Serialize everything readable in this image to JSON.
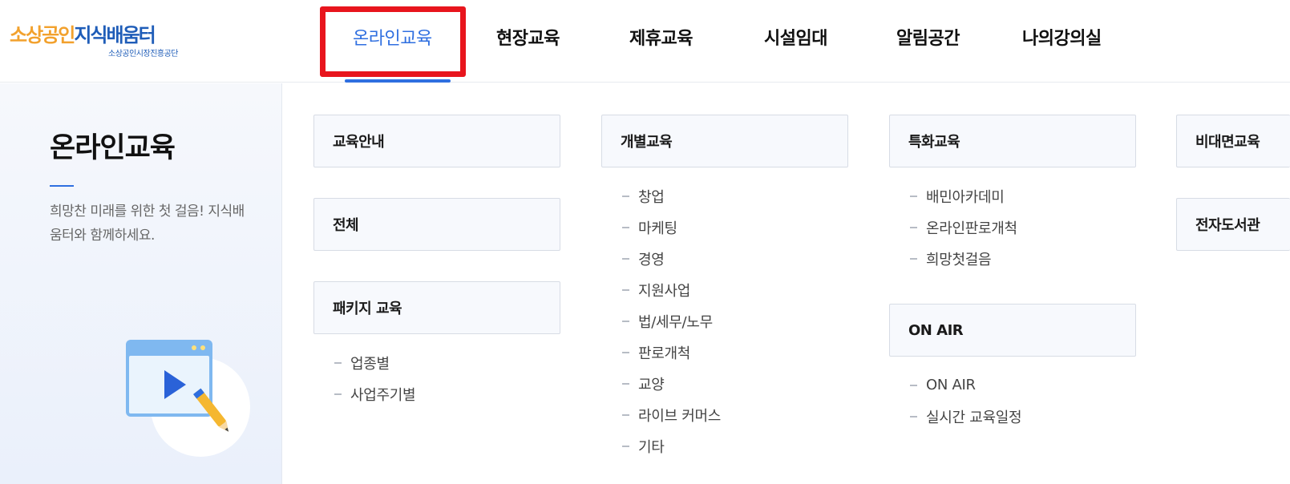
{
  "logo": {
    "main_part1": "소상공인",
    "main_part2": "지식배움터",
    "sub": "소상공인시장진흥공단"
  },
  "gnb": [
    {
      "label": "온라인교육",
      "active": true
    },
    {
      "label": "현장교육"
    },
    {
      "label": "제휴교육"
    },
    {
      "label": "시설임대"
    },
    {
      "label": "알림공간"
    },
    {
      "label": "나의강의실"
    }
  ],
  "side": {
    "title": "온라인교육",
    "description": "희망찬 미래를 위한 첫 걸음! 지식배움터와 함께하세요.",
    "illustration": "video-lesson-icon"
  },
  "columns": [
    {
      "sections": [
        {
          "title": "교육안내",
          "items": []
        },
        {
          "title": "전체",
          "items": []
        },
        {
          "title": "패키지 교육",
          "items": [
            "업종별",
            "사업주기별"
          ]
        }
      ]
    },
    {
      "sections": [
        {
          "title": "개별교육",
          "items": [
            "창업",
            "마케팅",
            "경영",
            "지원사업",
            "법/세무/노무",
            "판로개척",
            "교양",
            "라이브 커머스",
            "기타"
          ]
        }
      ]
    },
    {
      "sections": [
        {
          "title": "특화교육",
          "items": [
            "배민아카데미",
            "온라인판로개척",
            "희망첫걸음"
          ]
        },
        {
          "title": "ON AIR",
          "items": [
            "ON AIR",
            "실시간 교육일정"
          ]
        }
      ]
    },
    {
      "sections": [
        {
          "title": "비대면교육",
          "items": []
        },
        {
          "title": "전자도서관",
          "items": []
        }
      ]
    }
  ],
  "colors": {
    "accent": "#2f6fe0",
    "highlight": "#e8151d",
    "logo_orange": "#f2a12d",
    "logo_blue": "#1f5db8"
  }
}
